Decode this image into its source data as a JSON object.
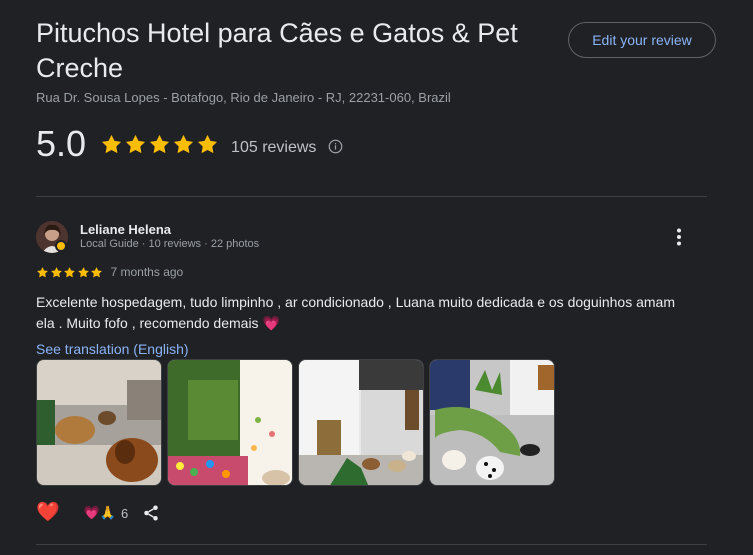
{
  "place": {
    "name": "Pituchos Hotel para Cães e Gatos & Pet Creche",
    "address": "Rua Dr. Sousa Lopes - Botafogo, Rio de Janeiro - RJ, 22231-060, Brazil",
    "rating": "5.0",
    "star_count": 5,
    "review_count_label": "105 reviews"
  },
  "actions": {
    "edit_review_label": "Edit your review"
  },
  "review": {
    "author": "Leliane Helena",
    "author_meta": "Local Guide · 10 reviews · 22 photos",
    "star_count": 5,
    "time": "7 months ago",
    "text": "Excelente hospedagem, tudo limpinho , ar condicionado , Luana muito dedicada e os doguinhos amam ela . Muito fofo , recomendo demais 💗",
    "translation_link": "See translation (English)",
    "photo_count": 4,
    "reactions": {
      "emojis": "💗🙏",
      "count": "6",
      "love_icon": "❤️"
    }
  },
  "colors": {
    "background": "#202124",
    "star": "#fbbc04",
    "link": "#8ab4f8",
    "text_primary": "#e8eaed",
    "text_secondary": "#9aa0a6",
    "divider": "#3c4043"
  },
  "icons": {
    "info": "info-icon",
    "more": "more-vert-icon",
    "share": "share-icon",
    "star": "star-icon"
  }
}
